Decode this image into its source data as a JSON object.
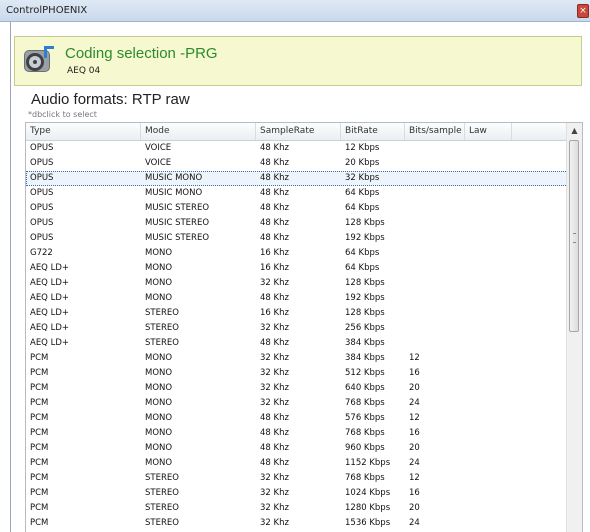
{
  "window": {
    "title": "ControlPHOENIX",
    "close_glyph": "×"
  },
  "header": {
    "title": "Coding selection -PRG",
    "subtitle": "AEQ 04",
    "icon": "speaker-disc-icon"
  },
  "section": {
    "title": "Audio formats: RTP raw",
    "hint": "*dbclick to select"
  },
  "table": {
    "columns": [
      "Type",
      "Mode",
      "SampleRate",
      "BitRate",
      "Bits/sample",
      "Law"
    ],
    "selected_index": 2,
    "rows": [
      [
        "OPUS",
        "VOICE",
        "48 Khz",
        "12 Kbps",
        "",
        ""
      ],
      [
        "OPUS",
        "VOICE",
        "48 Khz",
        "20 Kbps",
        "",
        ""
      ],
      [
        "OPUS",
        "MUSIC MONO",
        "48 Khz",
        "32 Kbps",
        "",
        ""
      ],
      [
        "OPUS",
        "MUSIC MONO",
        "48 Khz",
        "64 Kbps",
        "",
        ""
      ],
      [
        "OPUS",
        "MUSIC STEREO",
        "48 Khz",
        "64 Kbps",
        "",
        ""
      ],
      [
        "OPUS",
        "MUSIC STEREO",
        "48 Khz",
        "128 Kbps",
        "",
        ""
      ],
      [
        "OPUS",
        "MUSIC STEREO",
        "48 Khz",
        "192 Kbps",
        "",
        ""
      ],
      [
        "G722",
        "MONO",
        "16 Khz",
        "64 Kbps",
        "",
        ""
      ],
      [
        "AEQ LD+",
        "MONO",
        "16 Khz",
        "64 Kbps",
        "",
        ""
      ],
      [
        "AEQ LD+",
        "MONO",
        "32 Khz",
        "128 Kbps",
        "",
        ""
      ],
      [
        "AEQ LD+",
        "MONO",
        "48 Khz",
        "192 Kbps",
        "",
        ""
      ],
      [
        "AEQ LD+",
        "STEREO",
        "16 Khz",
        "128 Kbps",
        "",
        ""
      ],
      [
        "AEQ LD+",
        "STEREO",
        "32 Khz",
        "256 Kbps",
        "",
        ""
      ],
      [
        "AEQ LD+",
        "STEREO",
        "48 Khz",
        "384 Kbps",
        "",
        ""
      ],
      [
        "PCM",
        "MONO",
        "32 Khz",
        "384 Kbps",
        "12",
        ""
      ],
      [
        "PCM",
        "MONO",
        "32 Khz",
        "512 Kbps",
        "16",
        ""
      ],
      [
        "PCM",
        "MONO",
        "32 Khz",
        "640 Kbps",
        "20",
        ""
      ],
      [
        "PCM",
        "MONO",
        "32 Khz",
        "768 Kbps",
        "24",
        ""
      ],
      [
        "PCM",
        "MONO",
        "48 Khz",
        "576 Kbps",
        "12",
        ""
      ],
      [
        "PCM",
        "MONO",
        "48 Khz",
        "768 Kbps",
        "16",
        ""
      ],
      [
        "PCM",
        "MONO",
        "48 Khz",
        "960 Kbps",
        "20",
        ""
      ],
      [
        "PCM",
        "MONO",
        "48 Khz",
        "1152 Kbps",
        "24",
        ""
      ],
      [
        "PCM",
        "STEREO",
        "32 Khz",
        "768 Kbps",
        "12",
        ""
      ],
      [
        "PCM",
        "STEREO",
        "32 Khz",
        "1024 Kbps",
        "16",
        ""
      ],
      [
        "PCM",
        "STEREO",
        "32 Khz",
        "1280 Kbps",
        "20",
        ""
      ],
      [
        "PCM",
        "STEREO",
        "32 Khz",
        "1536 Kbps",
        "24",
        ""
      ]
    ]
  },
  "scrollbar": {
    "up_glyph": "▲"
  },
  "colors": {
    "header_bg": "#f6f8cf",
    "title_green": "#2d8a2d",
    "selection_outline": "#3a6ea5"
  }
}
